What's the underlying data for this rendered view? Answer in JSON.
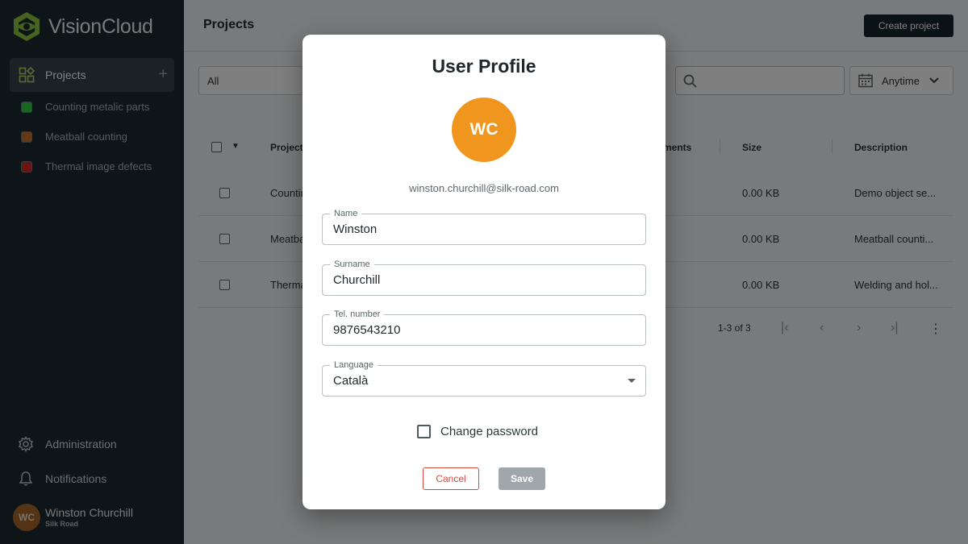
{
  "app": {
    "name": "VisionCloud"
  },
  "sidebar": {
    "projects_label": "Projects",
    "projects": [
      {
        "label": "Counting metalic parts",
        "color": "#2ecc40"
      },
      {
        "label": "Meatball counting",
        "color": "#c8702a"
      },
      {
        "label": "Thermal image defects",
        "color": "#d6262a"
      }
    ],
    "administration": "Administration",
    "notifications": "Notifications",
    "user": {
      "initials": "WC",
      "name": "Winston Churchill",
      "org": "Silk Road"
    }
  },
  "header": {
    "title": "Projects",
    "create_button": "Create project"
  },
  "filters": {
    "scope": "All",
    "date": "Anytime"
  },
  "table": {
    "headers": {
      "project": "Project",
      "experiments": "ments",
      "size": "Size",
      "description": "Description"
    },
    "rows": [
      {
        "name": "Countin",
        "size": "0.00 KB",
        "description": "Demo object se..."
      },
      {
        "name": "Meatba",
        "size": "0.00 KB",
        "description": "Meatball counti..."
      },
      {
        "name": "Therma",
        "size": "0.00 KB",
        "description": "Welding and hol..."
      }
    ],
    "pagination": "1-3 of 3"
  },
  "modal": {
    "title": "User Profile",
    "initials": "WC",
    "avatar_color": "#f0961e",
    "email": "winston.churchill@silk-road.com",
    "fields": {
      "name": {
        "label": "Name",
        "value": "Winston"
      },
      "surname": {
        "label": "Surname",
        "value": "Churchill"
      },
      "phone": {
        "label": "Tel. number",
        "value": "9876543210"
      },
      "language": {
        "label": "Language",
        "value": "Català"
      }
    },
    "change_password": "Change password",
    "cancel": "Cancel",
    "save": "Save"
  }
}
